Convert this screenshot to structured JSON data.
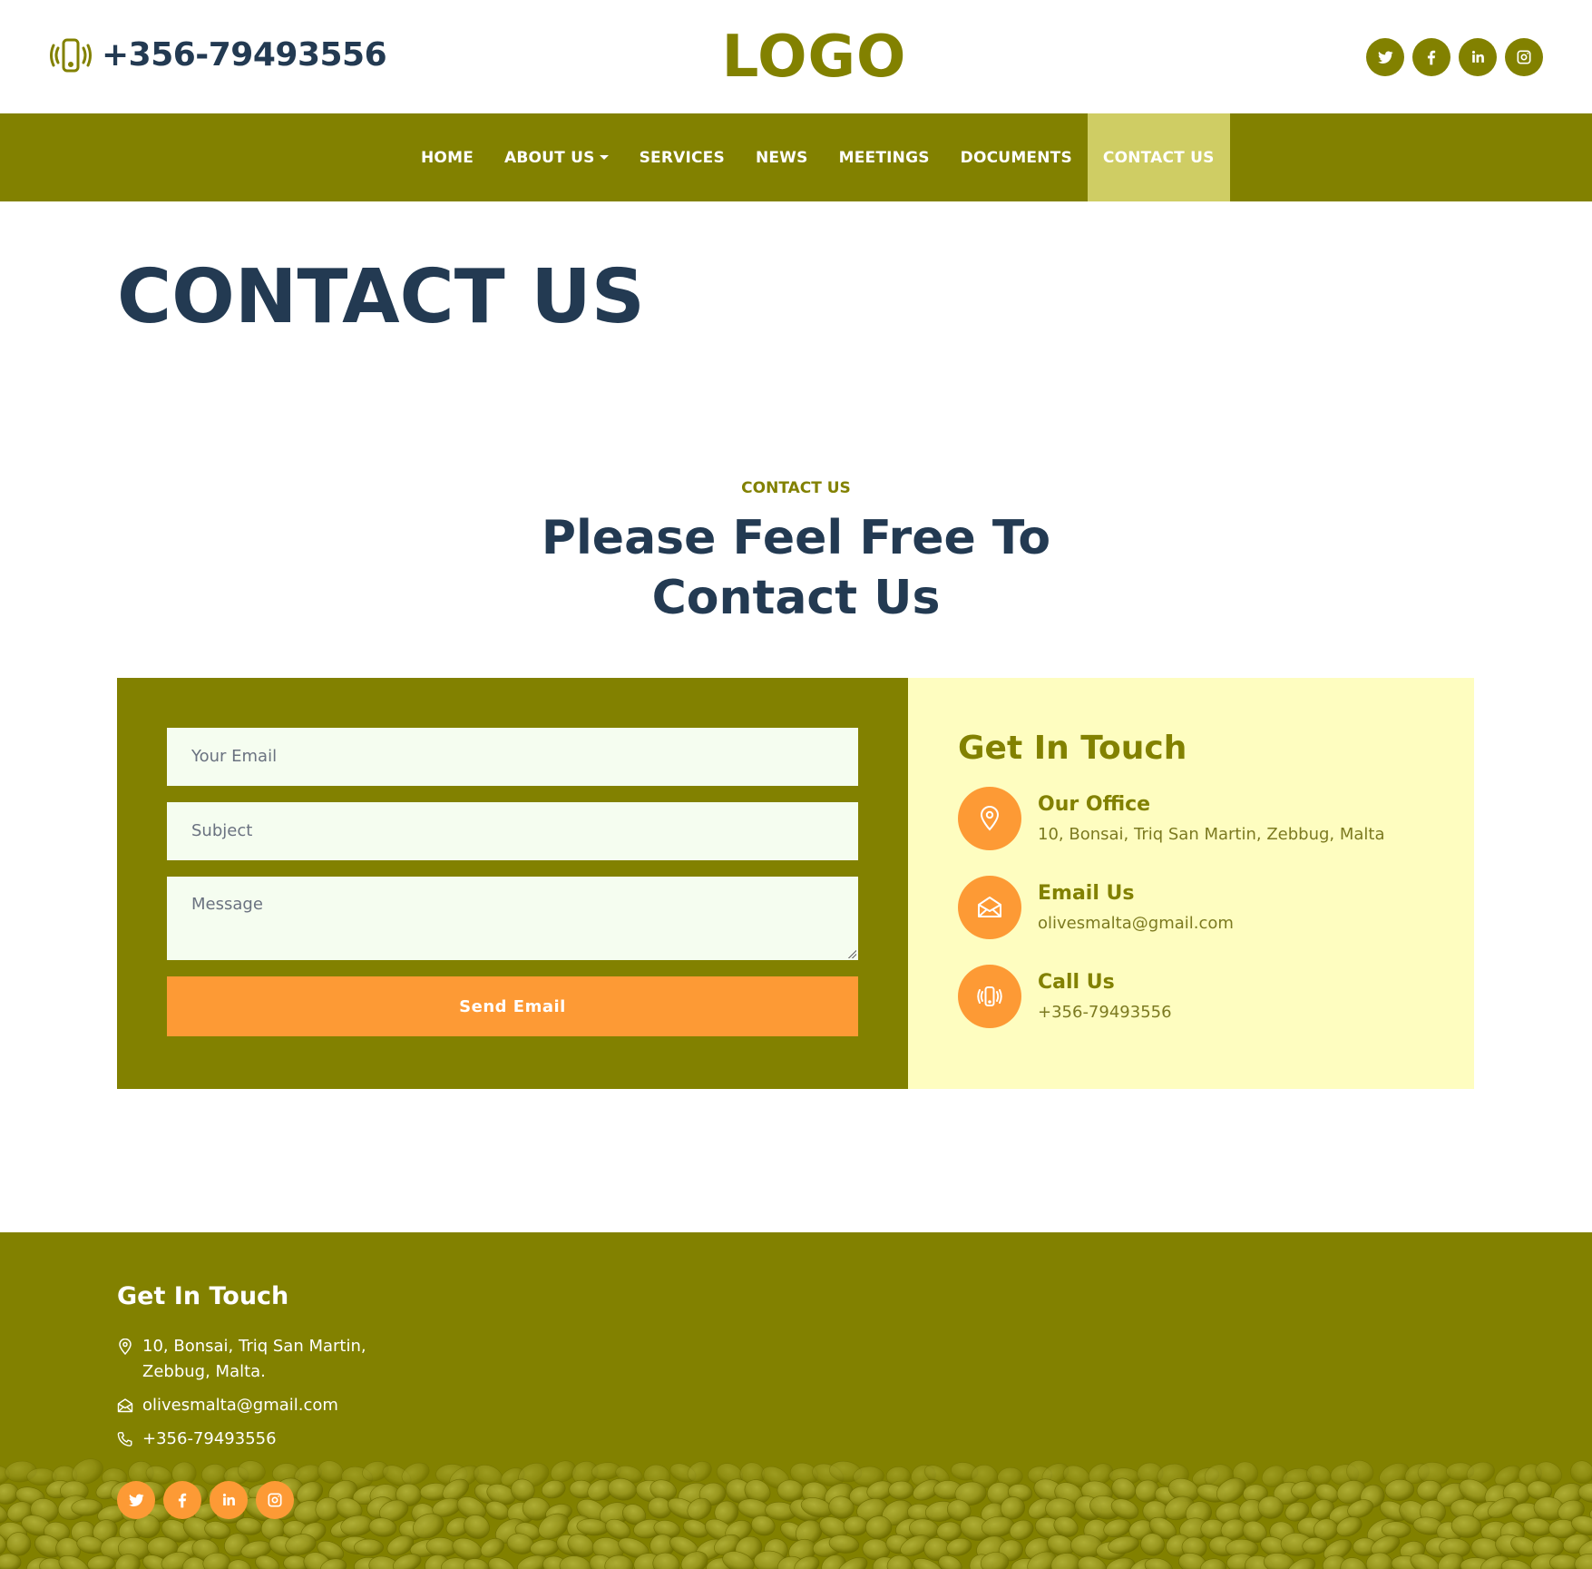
{
  "colors": {
    "olive": "#828100",
    "navy": "#233a52",
    "orange": "#fd9a35",
    "active_nav": "#cfcd64",
    "cream": "#fefdc0",
    "field_bg": "#f5fdf0"
  },
  "header": {
    "phone": "+356-79493556",
    "logo": "LOGO",
    "social": [
      "twitter-icon",
      "facebook-icon",
      "linkedin-icon",
      "instagram-icon"
    ]
  },
  "nav": {
    "items": [
      {
        "label": "HOME"
      },
      {
        "label": "ABOUT US"
      },
      {
        "label": "SERVICES"
      },
      {
        "label": "NEWS"
      },
      {
        "label": "MEETINGS"
      },
      {
        "label": "DOCUMENTS"
      },
      {
        "label": "CONTACT US",
        "active": true
      }
    ]
  },
  "page": {
    "title": "CONTACT US"
  },
  "section": {
    "eyebrow": "CONTACT US",
    "title_line1": "Please Feel Free To",
    "title_line2": "Contact Us"
  },
  "form": {
    "email_placeholder": "Your Email",
    "subject_placeholder": "Subject",
    "message_placeholder": "Message",
    "submit_label": "Send Email"
  },
  "info": {
    "title": "Get In Touch",
    "items": [
      {
        "icon": "map-pin-icon",
        "heading": "Our Office",
        "text": "10, Bonsai, Triq San Martin, Zebbug, Malta"
      },
      {
        "icon": "envelope-icon",
        "heading": "Email Us",
        "text": "olivesmalta@gmail.com"
      },
      {
        "icon": "phone-vibrate-icon",
        "heading": "Call Us",
        "text": "+356-79493556"
      }
    ]
  },
  "footer": {
    "title": "Get In Touch",
    "address_line1": "10, Bonsai, Triq San Martin,",
    "address_line2": "Zebbug, Malta.",
    "email": "olivesmalta@gmail.com",
    "phone": "+356-79493556",
    "social": [
      "twitter-icon",
      "facebook-icon",
      "linkedin-icon",
      "instagram-icon"
    ]
  }
}
